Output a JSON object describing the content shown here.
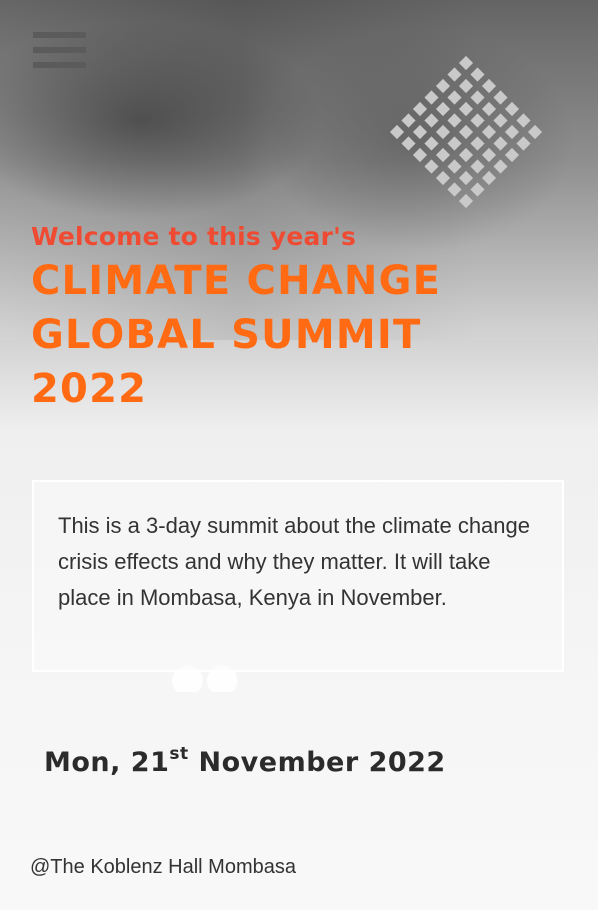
{
  "header": {
    "menu_icon": "hamburger-menu-icon",
    "decor_icon": "diamond-dot-pattern-icon"
  },
  "hero": {
    "welcome": "Welcome to this year's",
    "title_line1": "CLIMATE CHANGE",
    "title_line2": "GLOBAL SUMMIT",
    "title_line3": "2022"
  },
  "description": "This is a 3-day summit about the climate change crisis effects and why they matter. It will take place in Mombasa, Kenya in November.",
  "event": {
    "date_prefix": "Mon, 21",
    "date_suffix": "st",
    "date_rest": " November 2022",
    "venue": "@The Koblenz Hall Mombasa"
  },
  "colors": {
    "welcome": "#ef4b33",
    "title": "#ff6a13",
    "text": "#333333"
  }
}
